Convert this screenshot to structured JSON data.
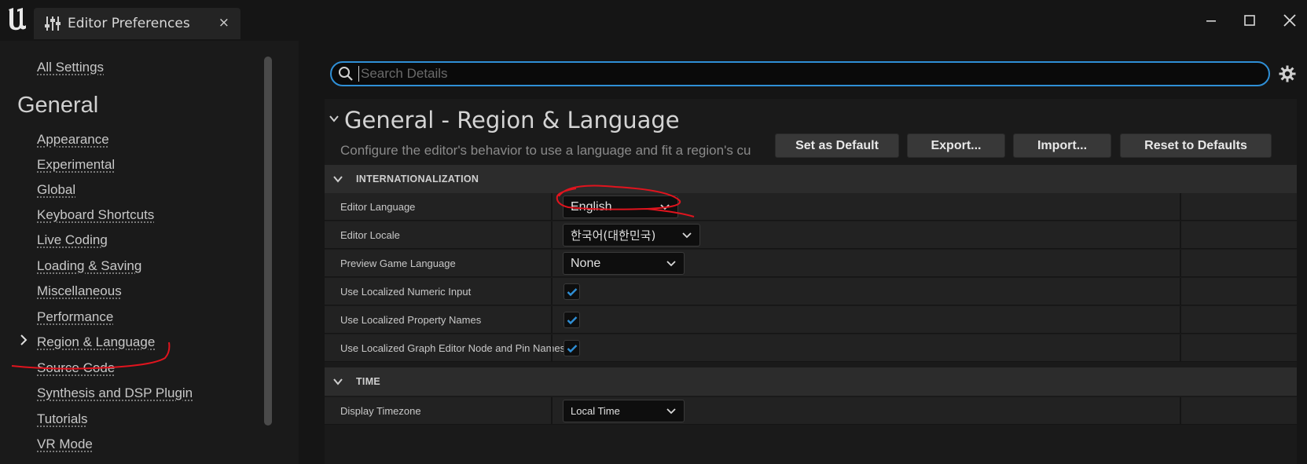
{
  "window": {
    "tab_title": "Editor Preferences",
    "tab_close": "×",
    "logo_icon": "unreal-logo-icon",
    "controls": [
      "minimize-icon",
      "maximize-icon",
      "close-icon"
    ]
  },
  "sidebar": {
    "top_link": "All Settings",
    "heading": "General",
    "active_marker": "›",
    "items": [
      {
        "label": "Appearance",
        "active": false
      },
      {
        "label": "Experimental",
        "active": false
      },
      {
        "label": "Global",
        "active": false
      },
      {
        "label": "Keyboard Shortcuts",
        "active": false
      },
      {
        "label": "Live Coding",
        "active": false
      },
      {
        "label": "Loading & Saving",
        "active": false
      },
      {
        "label": "Miscellaneous",
        "active": false
      },
      {
        "label": "Performance",
        "active": false
      },
      {
        "label": "Region & Language",
        "active": true
      },
      {
        "label": "Source Code",
        "active": false
      },
      {
        "label": "Synthesis and DSP Plugin",
        "active": false
      },
      {
        "label": "Tutorials",
        "active": false
      },
      {
        "label": "VR Mode",
        "active": false
      }
    ]
  },
  "search": {
    "placeholder": "Search Details",
    "value": ""
  },
  "details": {
    "title": "General - Region & Language",
    "description": "Configure the editor's behavior to use a language and fit a region's cu",
    "buttons": {
      "set_default": "Set as Default",
      "export": "Export...",
      "import": "Import...",
      "reset": "Reset to Defaults"
    },
    "categories": [
      {
        "label": "INTERNATIONALIZATION",
        "properties": [
          {
            "name": "Editor Language",
            "type": "dropdown",
            "value": "English"
          },
          {
            "name": "Editor Locale",
            "type": "dropdown",
            "value": "한국어(대한민국)"
          },
          {
            "name": "Preview Game Language",
            "type": "dropdown",
            "value": "None"
          },
          {
            "name": "Use Localized Numeric Input",
            "type": "checkbox",
            "checked": true
          },
          {
            "name": "Use Localized Property Names",
            "type": "checkbox",
            "checked": true
          },
          {
            "name": "Use Localized Graph Editor Node and Pin Names",
            "type": "checkbox",
            "checked": true
          }
        ]
      },
      {
        "label": "TIME",
        "properties": [
          {
            "name": "Display Timezone",
            "type": "dropdown",
            "value": "Local Time"
          }
        ]
      }
    ]
  },
  "colors": {
    "accent": "#2f8fd6",
    "annotation": "#e0141e",
    "check": "#2f8fd6"
  }
}
